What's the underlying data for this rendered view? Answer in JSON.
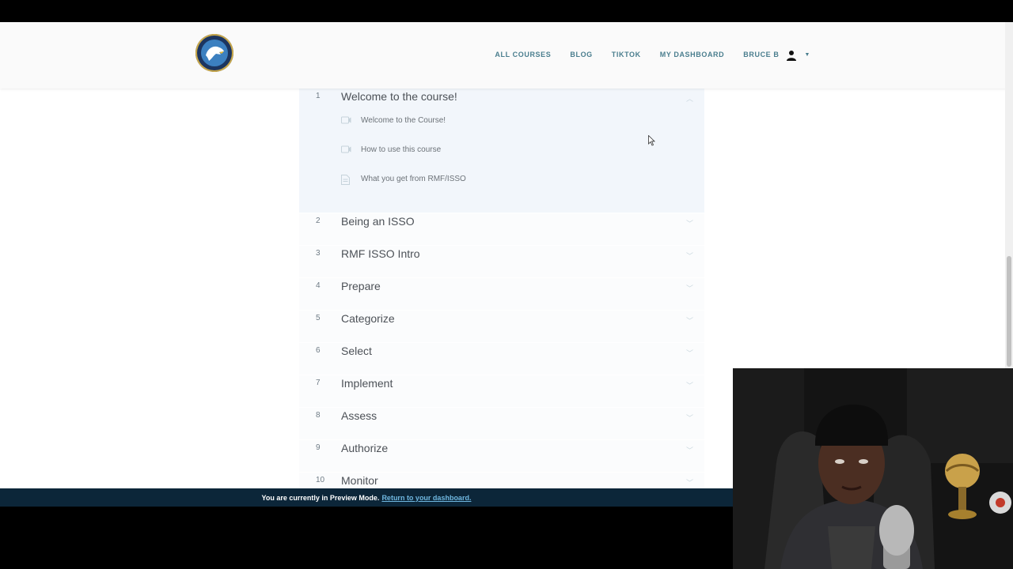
{
  "header": {
    "nav": [
      "ALL COURSES",
      "BLOG",
      "TIKTOK",
      "MY DASHBOARD"
    ],
    "user_name": "BRUCE B"
  },
  "icons": {
    "logo": "eagle-logo-icon",
    "user": "user-avatar-icon",
    "caret": "caret-down-icon",
    "video": "video-icon",
    "document": "document-icon",
    "chevron": "chevron-icon"
  },
  "sections": [
    {
      "num": "1",
      "title": "Welcome to the course!",
      "lessons": [
        {
          "title": "Welcome to the Course!"
        },
        {
          "title": "How to use this course"
        },
        {
          "title": "What you get from RMF/ISSO"
        }
      ]
    },
    {
      "num": "2",
      "title": "Being an ISSO"
    },
    {
      "num": "3",
      "title": "RMF ISSO Intro"
    },
    {
      "num": "4",
      "title": "Prepare"
    },
    {
      "num": "5",
      "title": "Categorize"
    },
    {
      "num": "6",
      "title": "Select"
    },
    {
      "num": "7",
      "title": "Implement"
    },
    {
      "num": "8",
      "title": "Assess"
    },
    {
      "num": "9",
      "title": "Authorize"
    },
    {
      "num": "10",
      "title": "Monitor"
    }
  ],
  "preview": {
    "message": "You are currently in Preview Mode.",
    "link": "Return to your dashboard."
  },
  "colors": {
    "nav_text": "#4a7e8e",
    "preview_bar": "#0c2639",
    "preview_link": "#6fb7e0",
    "active_section_bg": "#f2f6fb"
  }
}
